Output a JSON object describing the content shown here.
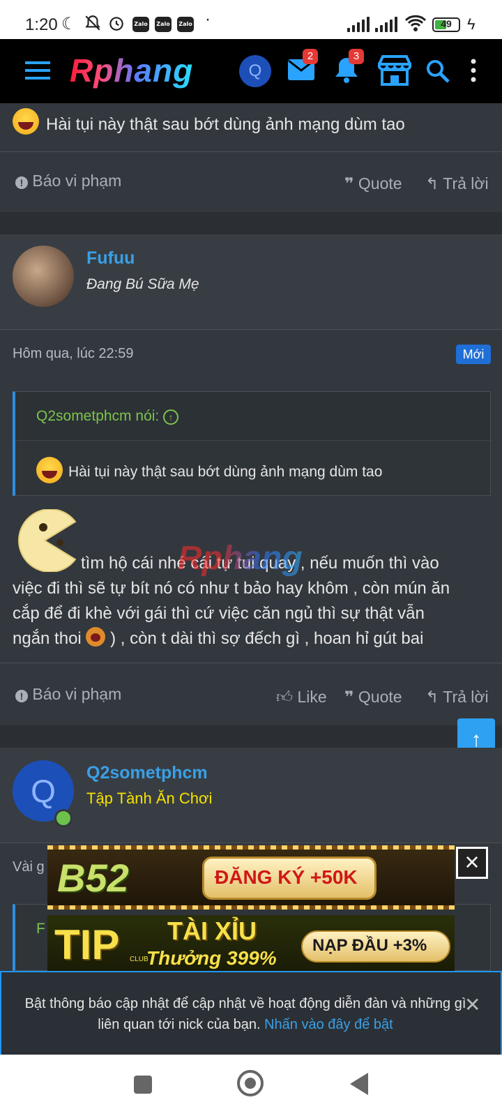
{
  "status_bar": {
    "time": "1:20",
    "battery": "49",
    "zalo_label": "Zalo"
  },
  "app_bar": {
    "logo": "Rphang",
    "avatar_letter": "Q",
    "inbox_count": "2",
    "alerts_count": "3"
  },
  "post_top": {
    "text": "Hài tụi này thật sau bớt dùng ảnh mạng dùm tao",
    "report_label": "Báo vi phạm",
    "quote_label": "Quote",
    "reply_label": "Trả lời"
  },
  "post_fufuu": {
    "username": "Fufuu",
    "user_title": "Đang Bú Sữa Mẹ",
    "timestamp": "Hôm qua, lúc 22:59",
    "new_badge": "Mới",
    "quote_author": "Q2sometphcm nói:",
    "quote_text": "Hài tụi này thật sau bớt dùng ảnh mạng dùm tao",
    "body_line1": "tìm hộ cái nhé cái tự tui quay , nếu muốn thì vào",
    "body_line2": "việc đi thì sẽ tự bít nó có như t bảo hay khôm , còn mún ăn",
    "body_line3": "cắp để đi khè với gái thì cứ việc căn ngủ thì sự thật vẫn",
    "body_line4a": "ngắn thoi",
    "body_line4b": ") , còn t dài thì sợ đếch gì , hoan hỉ gút bai",
    "report_label": "Báo vi phạm",
    "like_label": "Like",
    "quote_label": "Quote",
    "reply_label": "Trả lời"
  },
  "watermark": "Rphang",
  "post_q2": {
    "avatar_letter": "Q",
    "username": "Q2sometphcm",
    "user_title": "Tập Tành Ăn Chơi",
    "timestamp_partial": "Vài g",
    "quote_partial": "F"
  },
  "ads": {
    "ad1_brand": "B52",
    "ad1_cta": "ĐĂNG KÝ +50K",
    "ad2_brand": "TIP",
    "ad2_club": "CLUB",
    "ad2_title": "TÀI XỈU",
    "ad2_sub": "Thưởng 399%",
    "ad2_cta": "NẠP ĐẦU +3%"
  },
  "notification": {
    "message": "Bật thông báo cập nhật để cập nhật về hoạt động diễn đàn và những gì liên quan tới nick của bạn. ",
    "link": "Nhấn vào đây để bật"
  },
  "colors": {
    "accent": "#2ea1f2",
    "username": "#3aa0e6",
    "quote_author": "#7cc44a",
    "title_yellow": "#f5e100"
  }
}
